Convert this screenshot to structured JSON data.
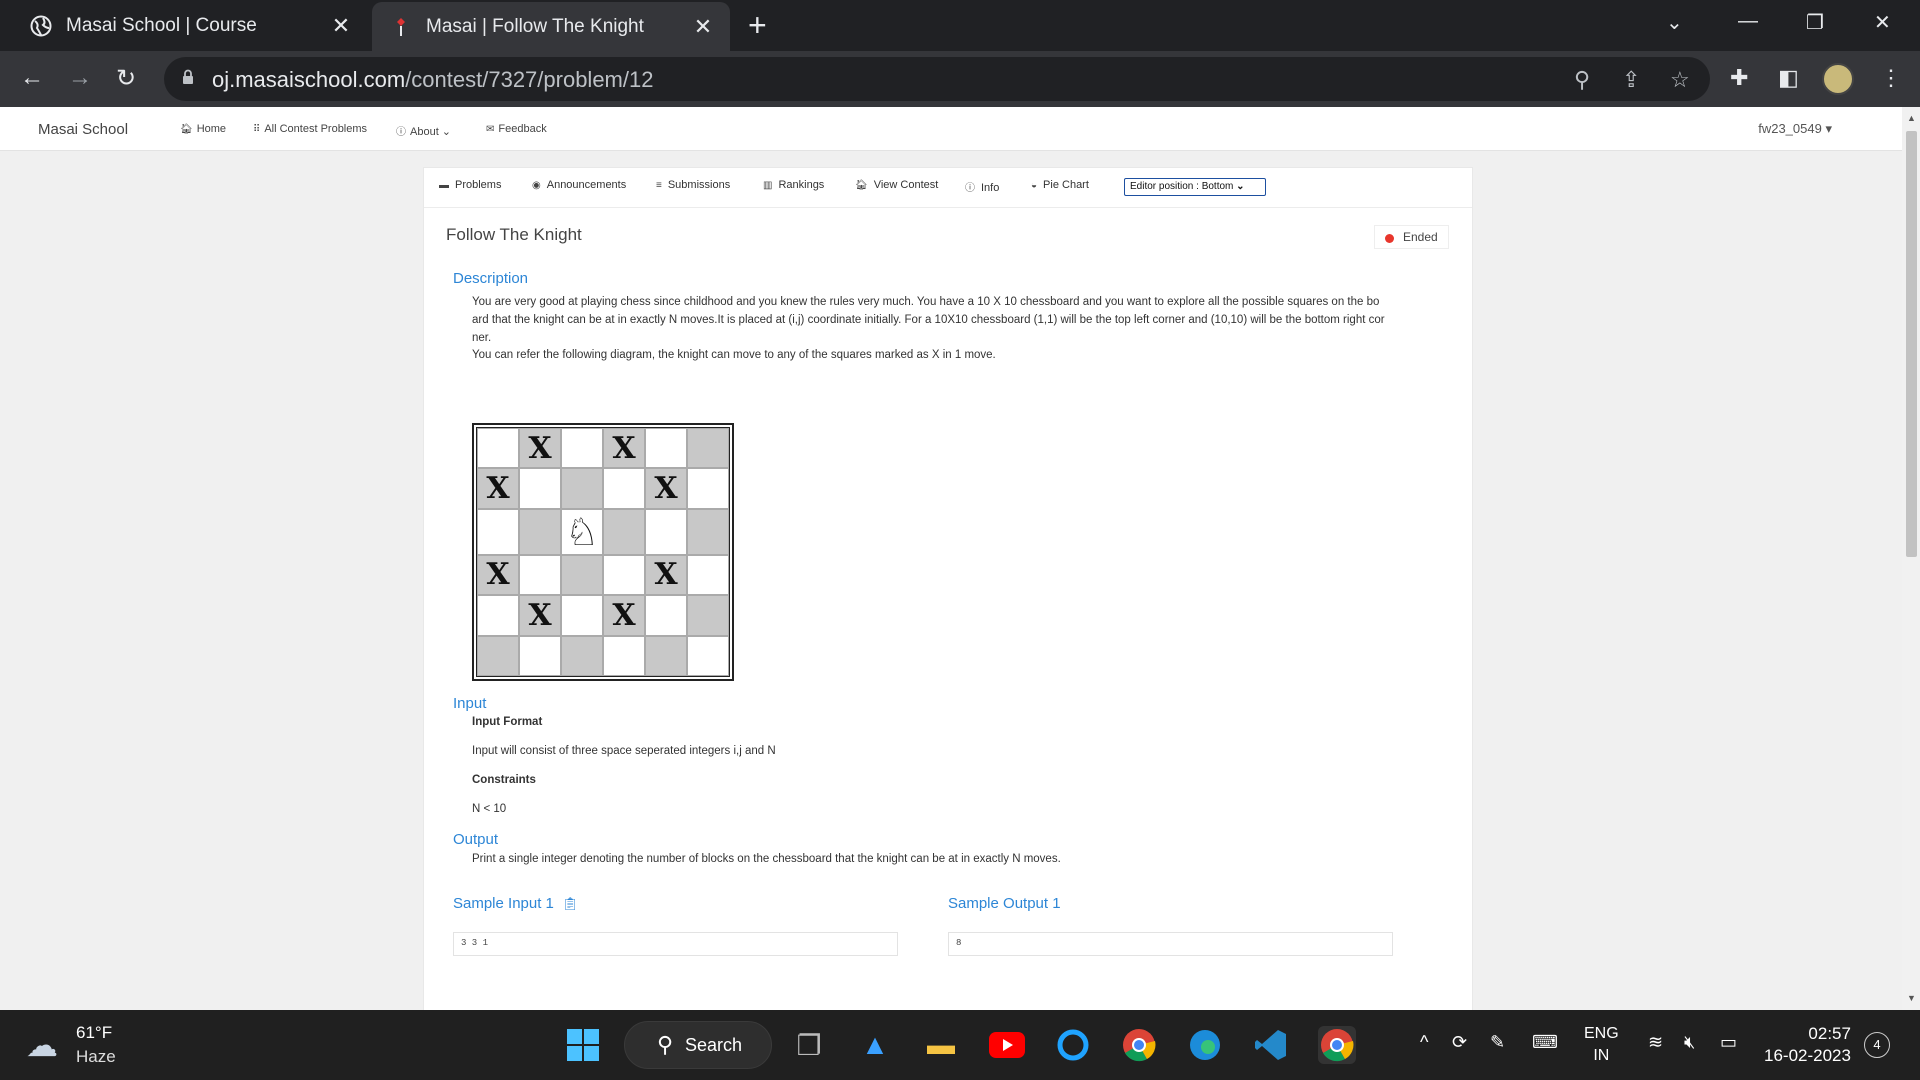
{
  "browser": {
    "tabs": [
      {
        "title": "Masai School | Course"
      },
      {
        "title": "Masai | Follow The Knight"
      }
    ],
    "url_host": "oj.masaischool.com",
    "url_path": "/contest/7327/problem/12"
  },
  "site": {
    "brand": "Masai School",
    "nav": [
      "Home",
      "All Contest Problems",
      "About",
      "Feedback"
    ],
    "user": "fw23_0549"
  },
  "contest_nav": {
    "tabs": [
      "Problems",
      "Announcements",
      "Submissions",
      "Rankings",
      "View Contest",
      "Info",
      "Pie Chart"
    ],
    "editor_position": "Editor position : Bottom"
  },
  "problem": {
    "title": "Follow The Knight",
    "status": "Ended",
    "description_heading": "Description",
    "description_line1": "You are very good at playing chess since childhood and you knew the rules very much. You have a  10 X 10 chessboard and you want to explore all the possible squares on the bo",
    "description_line2": "ard that the knight can be at in exactly N moves.It is placed at (i,j) coordinate initially. For a 10X10 chessboard (1,1) will be the top left corner and (10,10) will be the bottom right cor",
    "description_line3": "ner.",
    "diagram_note": "You can refer the following diagram, the knight can move to any of the squares marked as X in 1 move.",
    "board": [
      [
        "",
        "X",
        "",
        "X",
        "",
        ""
      ],
      [
        "X",
        "",
        "",
        "",
        "X",
        ""
      ],
      [
        "",
        "",
        "♘",
        "",
        "",
        ""
      ],
      [
        "X",
        "",
        "",
        "",
        "X",
        ""
      ],
      [
        "",
        "X",
        "",
        "X",
        "",
        ""
      ],
      [
        "",
        "",
        "",
        "",
        "",
        ""
      ]
    ],
    "input_heading": "Input",
    "input_format_label": "Input Format",
    "input_format": "Input will consist of three space seperated integers i,j and N",
    "constraints_label": "Constraints",
    "constraints": "N < 10",
    "output_heading": "Output",
    "output_text": "Print a single integer denoting the number of blocks on the chessboard that the knight can be at in exactly N moves.",
    "sample_input_label": "Sample Input 1",
    "sample_input": "3 3 1",
    "sample_output_label": "Sample Output 1",
    "sample_output": "8"
  },
  "taskbar": {
    "temperature": "61°F",
    "weather": "Haze",
    "search": "Search",
    "lang1": "ENG",
    "lang2": "IN",
    "time": "02:57",
    "date": "16-02-2023",
    "notifications": "4"
  }
}
